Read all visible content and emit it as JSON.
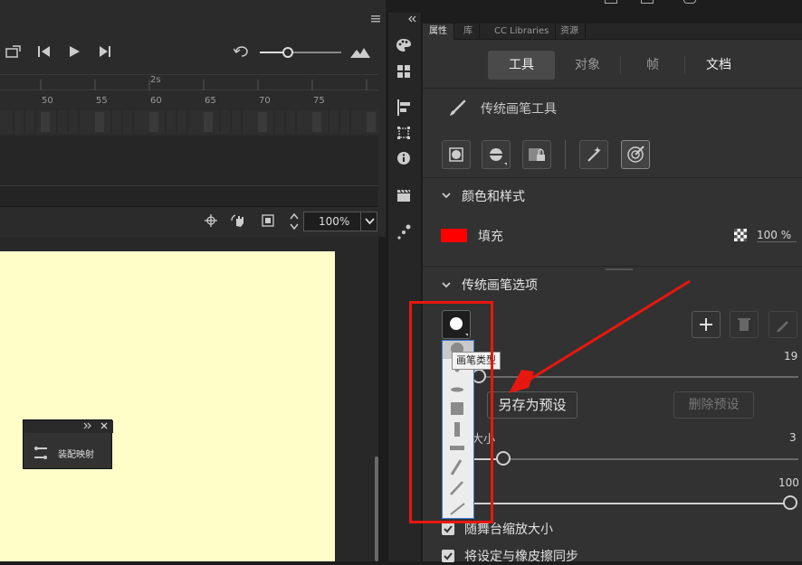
{
  "timeline": {
    "ruler_marker": "2s",
    "frame_labels": [
      "50",
      "55",
      "60",
      "65",
      "70",
      "75"
    ]
  },
  "stage_toolbar": {
    "zoom_value": "100%"
  },
  "mini_panel": {
    "label": "装配映射"
  },
  "properties_panel": {
    "tabs": [
      {
        "label": "属性",
        "active": true
      },
      {
        "label": "库",
        "active": false
      },
      {
        "label": "CC Libraries",
        "active": false
      },
      {
        "label": "资源",
        "active": false
      }
    ],
    "segments": {
      "tool": "工具",
      "object": "对象",
      "frame": "帧",
      "document": "文档"
    },
    "tool_name": "传统画笔工具",
    "color_section": {
      "title": "颜色和样式",
      "fill_label": "填充",
      "fill_color": "#ff0000",
      "opacity": "100 %"
    },
    "brush_section": {
      "title": "传统画笔选项",
      "tooltip": "画笔类型",
      "value_top": "19",
      "save_preset": "另存为预设",
      "delete_preset": "删除预设",
      "size_label_partial": "大小",
      "size_value": "3",
      "smooth_value": "100",
      "checkbox1": "随舞台缩放大小",
      "checkbox2": "将设定与橡皮擦同步"
    }
  },
  "colors": {
    "accent_red": "#e8170f",
    "stage": "#fffec9"
  }
}
